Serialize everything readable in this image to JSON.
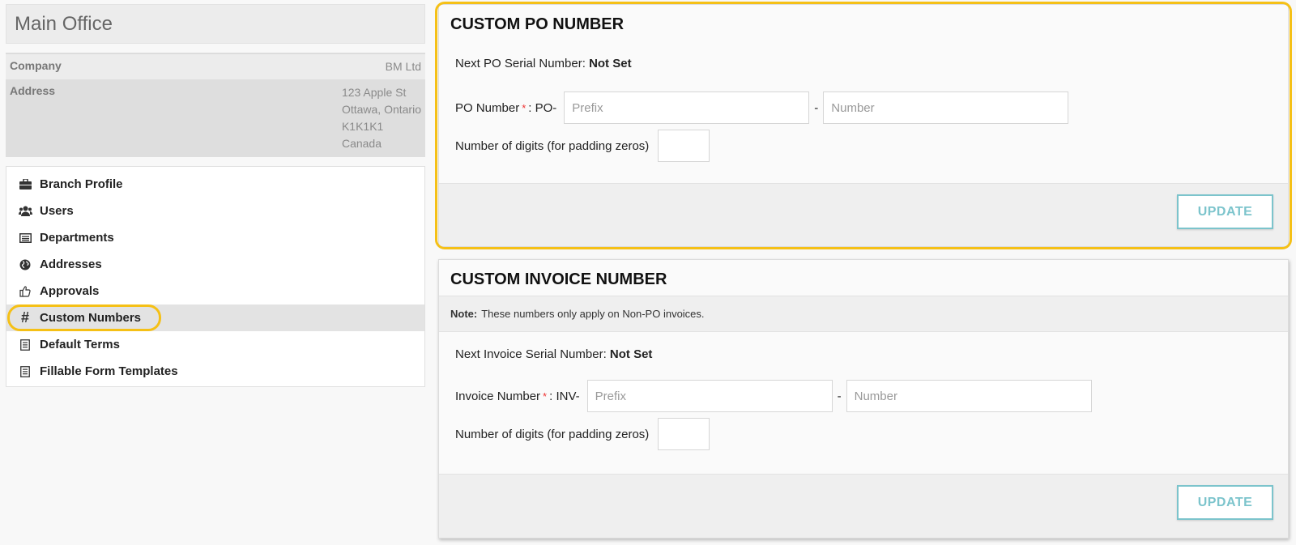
{
  "office": {
    "title": "Main Office"
  },
  "info": {
    "company_label": "Company",
    "company_value": "BM Ltd",
    "address_label": "Address",
    "address_lines": [
      "123 Apple St",
      "Ottawa, Ontario",
      "K1K1K1",
      "Canada"
    ]
  },
  "nav": {
    "items": [
      {
        "label": "Branch Profile",
        "icon": "briefcase-icon"
      },
      {
        "label": "Users",
        "icon": "users-icon"
      },
      {
        "label": "Departments",
        "icon": "list-icon"
      },
      {
        "label": "Addresses",
        "icon": "globe-icon"
      },
      {
        "label": "Approvals",
        "icon": "thumbs-up-icon"
      },
      {
        "label": "Custom Numbers",
        "icon": "hash-icon",
        "active": true
      },
      {
        "label": "Default Terms",
        "icon": "document-icon"
      },
      {
        "label": "Fillable Form Templates",
        "icon": "document-icon"
      }
    ]
  },
  "po_panel": {
    "title": "CUSTOM PO NUMBER",
    "serial_label": "Next PO Serial Number:",
    "serial_value": "Not Set",
    "number_label": "PO Number",
    "required_mark": "*",
    "number_prefix_text": ": PO-",
    "prefix_placeholder": "Prefix",
    "number_placeholder": "Number",
    "dash": "-",
    "digits_label": "Number of digits (for padding zeros)",
    "digits_value": "",
    "update_label": "UPDATE"
  },
  "invoice_panel": {
    "title": "CUSTOM INVOICE NUMBER",
    "note_label": "Note:",
    "note_text": "These numbers only apply on Non-PO invoices.",
    "serial_label": "Next Invoice Serial Number:",
    "serial_value": "Not Set",
    "number_label": "Invoice Number",
    "required_mark": "*",
    "number_prefix_text": ": INV-",
    "prefix_placeholder": "Prefix",
    "number_placeholder": "Number",
    "dash": "-",
    "digits_label": "Number of digits (for padding zeros)",
    "digits_value": "",
    "update_label": "UPDATE"
  },
  "colors": {
    "highlight": "#f5c016",
    "button_accent": "#7cc4cc",
    "required": "#ee3333"
  }
}
